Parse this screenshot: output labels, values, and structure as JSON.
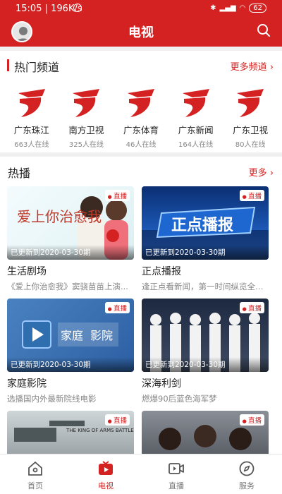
{
  "status_bar": {
    "time": "15:05",
    "speed": "196K/s",
    "battery": "62"
  },
  "header": {
    "title": "电视"
  },
  "channels_section": {
    "title": "热门频道",
    "more": "更多频道",
    "items": [
      {
        "name": "广东珠江",
        "count": "663人在线"
      },
      {
        "name": "南方卫视",
        "count": "325人在线"
      },
      {
        "name": "广东体育",
        "count": "46人在线"
      },
      {
        "name": "广东新闻",
        "count": "164人在线"
      },
      {
        "name": "广东卫视",
        "count": "80人在线"
      }
    ]
  },
  "hot_section": {
    "title": "热播",
    "more": "更多",
    "items": [
      {
        "title": "生活剧场",
        "subtitle": "《爱上你治愈我》窦骁苗苗上演...",
        "updated": "已更新到2020-03-30期",
        "badge": "直播",
        "thumb_text": "爱上你治愈我"
      },
      {
        "title": "正点播报",
        "subtitle": "逢正点看新闻，第一时间纵览全球...",
        "updated": "已更新到2020-03-30期",
        "badge": "直播",
        "thumb_text": "正点播报"
      },
      {
        "title": "家庭影院",
        "subtitle": "选播国内外最新院线电影",
        "updated": "已更新到2020-03-30期",
        "badge": "直播",
        "thumb_text_a": "家庭",
        "thumb_text_b": "影院"
      },
      {
        "title": "深海利剑",
        "subtitle": "燃爆90后蓝色海军梦",
        "updated": "已更新到2020-03-30期",
        "badge": "直播",
        "thumb_text": ""
      },
      {
        "title": "",
        "subtitle": "",
        "updated": "",
        "badge": "直播",
        "thumb_text": "THE KING OF ARMS BATTLE"
      },
      {
        "title": "",
        "subtitle": "",
        "updated": "",
        "badge": "直播",
        "thumb_text": ""
      }
    ]
  },
  "bottom_nav": {
    "items": [
      {
        "label": "首页"
      },
      {
        "label": "电视"
      },
      {
        "label": "直播"
      },
      {
        "label": "服务"
      }
    ],
    "active_color": "#d42222"
  },
  "colors": {
    "brand": "#d42222"
  }
}
